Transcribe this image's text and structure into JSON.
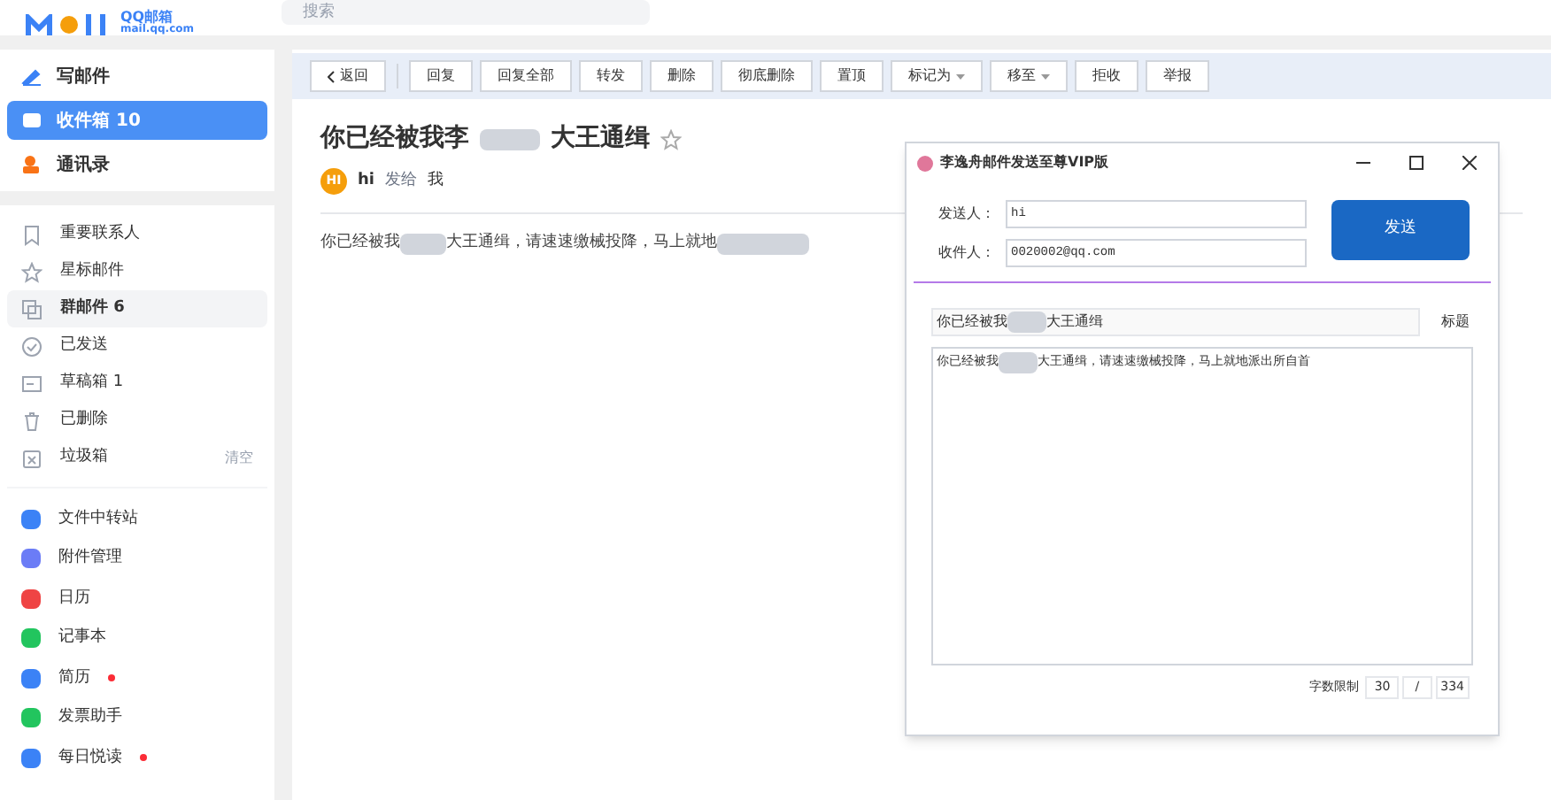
{
  "header": {
    "logo_text": "QQ邮箱",
    "logo_sub": "mail.qq.com",
    "search": {
      "placeholder": "搜索"
    }
  },
  "sidebar": {
    "top_items": [
      {
        "label": "写邮件",
        "kind": "compose",
        "selected": false
      },
      {
        "label": "收件箱",
        "count": "10",
        "kind": "inbox",
        "selected": true
      },
      {
        "label": "通讯录",
        "kind": "contacts",
        "selected": false
      }
    ],
    "folders": [
      {
        "label": "重要联系人",
        "kind": "bookmark",
        "selected": false
      },
      {
        "label": "星标邮件",
        "kind": "star",
        "selected": false
      },
      {
        "label": "群邮件",
        "count": "6",
        "kind": "group",
        "selected": true
      },
      {
        "label": "已发送",
        "kind": "sent",
        "selected": false
      },
      {
        "label": "草稿箱",
        "count": "1",
        "kind": "draft",
        "selected": false
      },
      {
        "label": "已删除",
        "kind": "trash",
        "selected": false
      },
      {
        "label": "垃圾箱",
        "kind": "spam",
        "selected": false,
        "action": "清空"
      }
    ],
    "apps": [
      {
        "label": "文件中转站",
        "color": "#3b82f6",
        "badge": false
      },
      {
        "label": "附件管理",
        "color": "#6b7cf6",
        "badge": false
      },
      {
        "label": "日历",
        "color": "#ef4444",
        "badge": false
      },
      {
        "label": "记事本",
        "color": "#22c55e",
        "badge": false
      },
      {
        "label": "简历",
        "color": "#3b82f6",
        "badge": true
      },
      {
        "label": "发票助手",
        "color": "#22c55e",
        "badge": false
      },
      {
        "label": "每日悦读",
        "color": "#3b82f6",
        "badge": true
      }
    ]
  },
  "toolbar": {
    "buttons": [
      {
        "label": "返回",
        "kind": "back"
      },
      {
        "label": "回复",
        "kind": "plain"
      },
      {
        "label": "回复全部",
        "kind": "plain"
      },
      {
        "label": "转发",
        "kind": "plain"
      },
      {
        "label": "删除",
        "kind": "plain"
      },
      {
        "label": "彻底删除",
        "kind": "plain"
      },
      {
        "label": "置顶",
        "kind": "plain"
      },
      {
        "label": "标记为",
        "kind": "menu"
      },
      {
        "label": "移至",
        "kind": "menu"
      },
      {
        "label": "拒收",
        "kind": "plain"
      },
      {
        "label": "举报",
        "kind": "plain"
      }
    ]
  },
  "email": {
    "subject": [
      "你已经被我李",
      "大王通缉"
    ],
    "starred": false,
    "avatar": "HI",
    "sender": "hi",
    "sent_to_label": "发给",
    "recipient": "我",
    "body": [
      "你已经被我",
      "大王通缉，请速速缴械投降，马上就地"
    ]
  },
  "dialog": {
    "title": "李逸舟邮件发送至尊VIP版",
    "sender_label": "发送人：",
    "sender_value": "hi",
    "recipient_label": "收件人：",
    "recipient_value": "0020002@qq.com",
    "send_button": "发送",
    "subject": [
      "你已经被我",
      "大王通缉"
    ],
    "subject_label": "标题",
    "body": [
      "你已经被我",
      "大王通缉，请速速缴械投降，马上就地派出所自首"
    ],
    "limit_label": "字数限制",
    "count": "30",
    "separator": "/",
    "limit": "334"
  }
}
